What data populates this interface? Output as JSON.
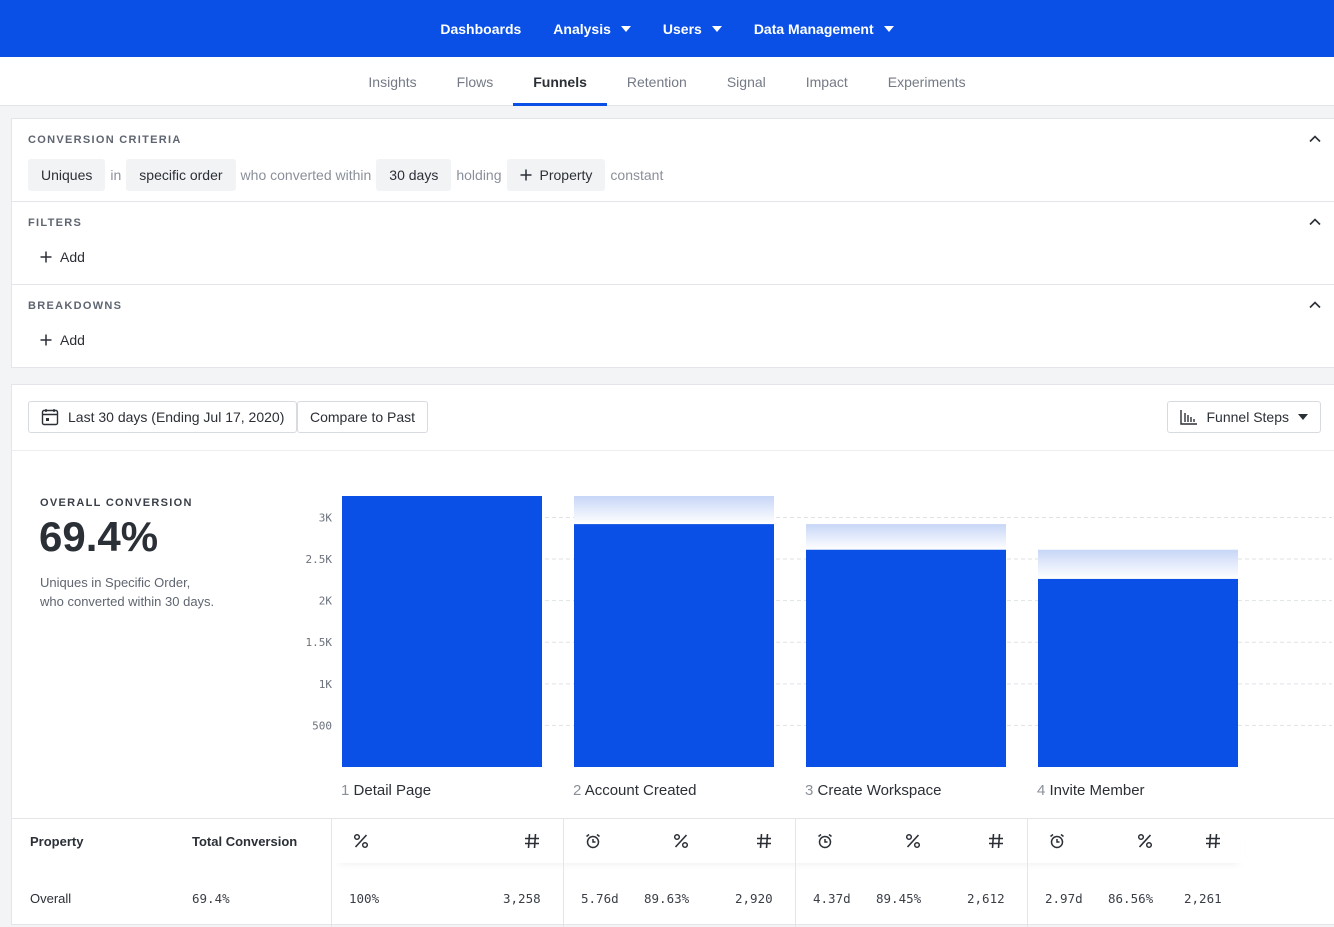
{
  "topnav": {
    "items": [
      {
        "label": "Dashboards",
        "dropdown": false
      },
      {
        "label": "Analysis",
        "dropdown": true
      },
      {
        "label": "Users",
        "dropdown": true
      },
      {
        "label": "Data Management",
        "dropdown": true
      }
    ]
  },
  "subnav": {
    "tabs": [
      "Insights",
      "Flows",
      "Funnels",
      "Retention",
      "Signal",
      "Impact",
      "Experiments"
    ],
    "active": "Funnels"
  },
  "criteria": {
    "title": "CONVERSION CRITERIA",
    "counting": "Uniques",
    "in": "in",
    "order": "specific order",
    "who_converted": "who converted within",
    "window": "30 days",
    "holding": "holding",
    "property": "Property",
    "constant": "constant"
  },
  "filters": {
    "title": "FILTERS",
    "add_label": "Add"
  },
  "breakdowns": {
    "title": "BREAKDOWNS",
    "add_label": "Add"
  },
  "toolbar": {
    "date_range": "Last 30 days (Ending Jul 17, 2020)",
    "compare": "Compare to Past",
    "view": "Funnel Steps"
  },
  "overall": {
    "label": "OVERALL CONVERSION",
    "value": "69.4%",
    "desc_line1": "Uniques in Specific Order,",
    "desc_line2": "who converted within 30 days."
  },
  "chart_data": {
    "type": "bar",
    "categories": [
      "Detail Page",
      "Account Created",
      "Create Workspace",
      "Invite Member"
    ],
    "step_numbers": [
      "1",
      "2",
      "3",
      "4"
    ],
    "values": [
      3258,
      2920,
      2612,
      2261
    ],
    "ylim": [
      0,
      3258
    ],
    "yticks": [
      500,
      1000,
      1500,
      2000,
      2500,
      3000
    ],
    "ytick_labels": [
      "500",
      "1K",
      "1.5K",
      "2K",
      "2.5K",
      "3K"
    ],
    "bar_color": "#0a50e6",
    "dropoff_color": "#c7d6f7",
    "grid": true
  },
  "table": {
    "headers": {
      "property": "Property",
      "total": "Total Conversion"
    },
    "row": {
      "property": "Overall",
      "total": "69.4%",
      "steps": [
        {
          "time": "",
          "pct": "100%",
          "count": "3,258"
        },
        {
          "time": "5.76d",
          "pct": "89.63%",
          "count": "2,920"
        },
        {
          "time": "4.37d",
          "pct": "89.45%",
          "count": "2,612"
        },
        {
          "time": "2.97d",
          "pct": "86.56%",
          "count": "2,261"
        }
      ]
    }
  },
  "colors": {
    "brand": "#0a50e6"
  }
}
